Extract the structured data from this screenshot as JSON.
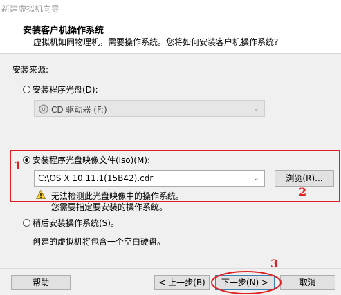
{
  "window": {
    "title": "新建虚拟机向导"
  },
  "header": {
    "title": "安装客户机操作系统",
    "subtitle": "虚拟机如同物理机，需要操作系统。您将如何安装客户机操作系统?"
  },
  "source_label": "安装来源:",
  "option_disc": {
    "label": "安装程序光盘(D):",
    "drive_value": "CD 驱动器 (F:)"
  },
  "option_iso": {
    "label": "安装程序光盘映像文件(iso)(M):",
    "path_value": "C:\\OS X 10.11.1(15B42).cdr",
    "browse_label": "浏览(R)...",
    "warning_text": "无法检测此光盘映像中的操作系统。",
    "hint_text": "您需要指定要安装的操作系统。"
  },
  "option_later": {
    "label": "稍后安装操作系统(S)。",
    "description": "创建的虚拟机将包含一个空白硬盘。"
  },
  "footer": {
    "help_label": "帮助",
    "back_label": "< 上一步(B)",
    "next_label": "下一步(N) >",
    "cancel_label": "取消"
  },
  "annotations": [
    "1",
    "2",
    "3"
  ],
  "colors": {
    "annotation": "#e02020"
  }
}
